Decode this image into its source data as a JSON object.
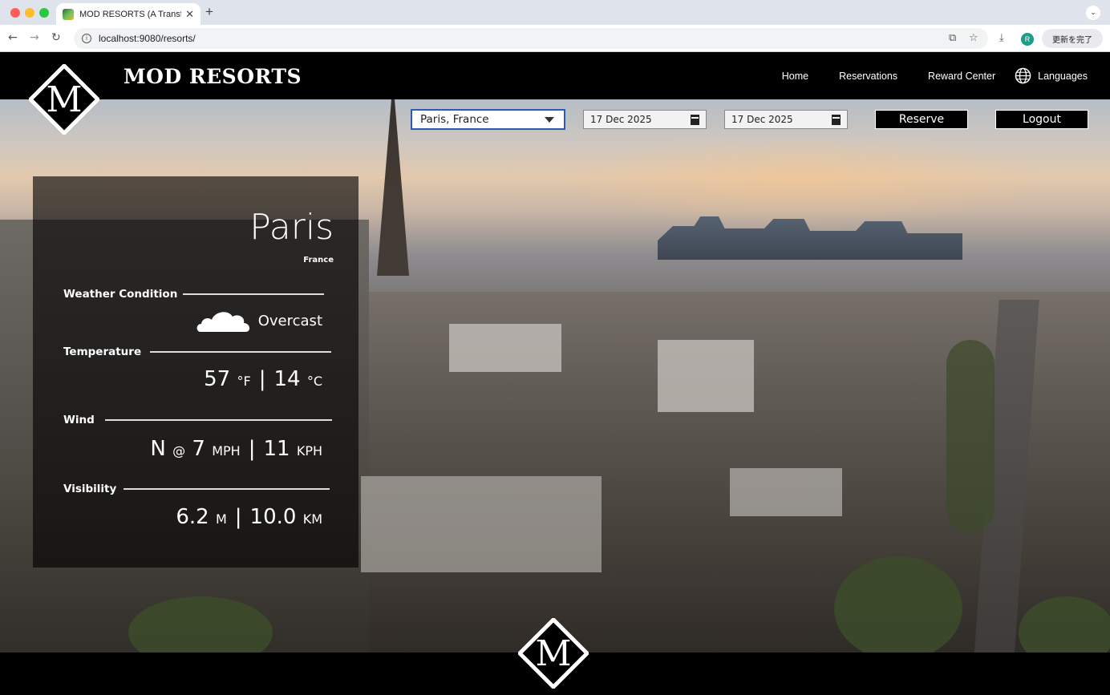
{
  "browser": {
    "tab_title": "MOD RESORTS (A Transform",
    "url": "localhost:9080/resorts/",
    "profile_initial": "R",
    "finish_update_label": "更新を完了"
  },
  "header": {
    "brand": "MOD RESORTS",
    "logo_letter": "M",
    "nav": {
      "home": "Home",
      "reservations": "Reservations",
      "reward_center": "Reward Center",
      "languages": "Languages"
    }
  },
  "controls": {
    "city_selected": "Paris, France",
    "check_in": "17 Dec 2025",
    "check_out": "17 Dec 2025",
    "reserve_label": "Reserve",
    "logout_label": "Logout"
  },
  "weather": {
    "city": "Paris",
    "country": "France",
    "condition_label": "Weather Condition",
    "condition": "Overcast",
    "temperature_label": "Temperature",
    "temp_f": "57",
    "temp_f_unit": "°F",
    "temp_c": "14",
    "temp_c_unit": "°C",
    "wind_label": "Wind",
    "wind_dir": "N",
    "wind_at": "@",
    "wind_mph": "7",
    "wind_mph_unit": "MPH",
    "wind_kph": "11",
    "wind_kph_unit": "KPH",
    "visibility_label": "Visibility",
    "vis_m": "6.2",
    "vis_m_unit": "M",
    "vis_km": "10.0",
    "vis_km_unit": "KM",
    "separator": "|"
  },
  "colors": {
    "header_bg": "#000000",
    "select_border": "#2a5db0",
    "panel_bg": "rgba(0,0,0,0.62)"
  }
}
